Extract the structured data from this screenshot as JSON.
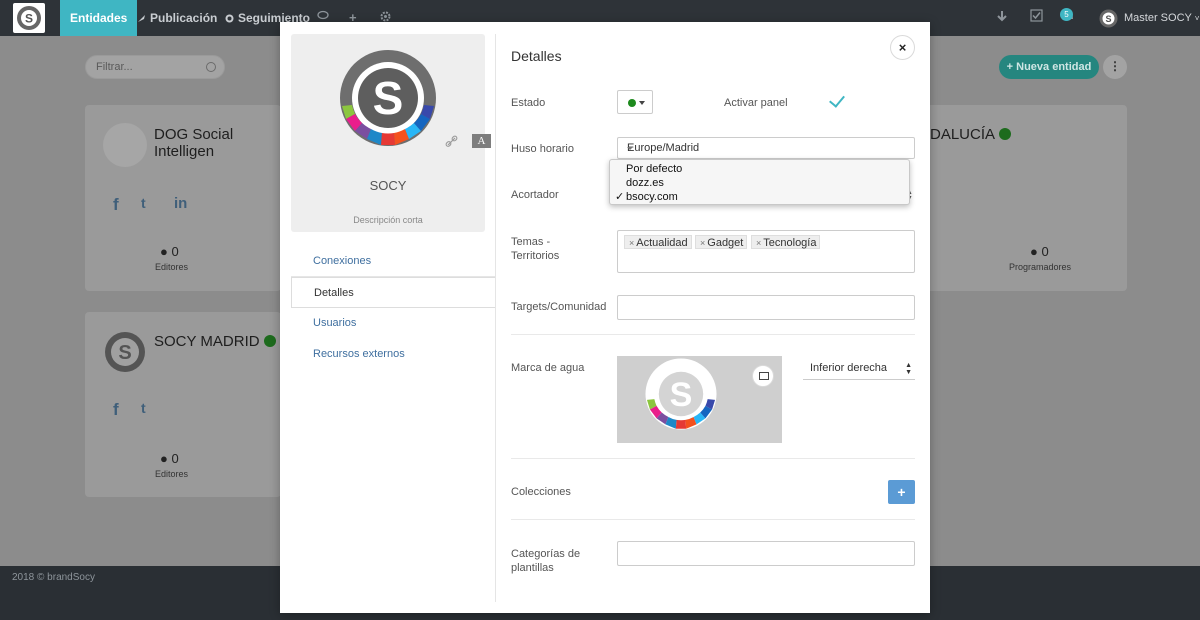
{
  "navbar": {
    "tabs": [
      {
        "label": "Entidades"
      },
      {
        "label": "Publicación"
      },
      {
        "label": "Seguimiento"
      }
    ],
    "notification_count": "5",
    "user_name": "Master SOCY"
  },
  "background": {
    "filter_placeholder": "Filtrar...",
    "new_entity_label": "Nueva entidad",
    "cards": [
      {
        "title": "DOG Social Intelligen",
        "count": "0",
        "count_label": "Editores"
      },
      {
        "title": "DALUCÍA",
        "count": "0",
        "count_label": "Programadores"
      },
      {
        "title": "SOCY MADRID",
        "count": "0",
        "count_label": "Editores"
      }
    ]
  },
  "footer": {
    "text": "2018 © brandSocy"
  },
  "modal": {
    "profile": {
      "name": "SOCY",
      "description": "Descripción corta",
      "font_icon_letter": "A"
    },
    "side_nav": [
      {
        "label": "Conexiones"
      },
      {
        "label": "Detalles"
      },
      {
        "label": "Usuarios"
      },
      {
        "label": "Recursos externos"
      }
    ],
    "title": "Detalles",
    "close": "×",
    "fields": {
      "estado": {
        "label": "Estado",
        "status_color": "#1d8a1d"
      },
      "activar_panel": {
        "label": "Activar panel",
        "checked": true
      },
      "huso_horario": {
        "label": "Huso horario",
        "value": "Europe/Madrid"
      },
      "acortador": {
        "label": "Acortador",
        "options": [
          "Por defecto",
          "dozz.es",
          "bsocy.com"
        ],
        "selected": "bsocy.com"
      },
      "temas": {
        "label_line1": "Temas -",
        "label_line2": "Territorios",
        "tags": [
          "Actualidad",
          "Gadget",
          "Tecnología"
        ]
      },
      "targets": {
        "label": "Targets/Comunidad",
        "value": ""
      },
      "marca_agua": {
        "label": "Marca de agua",
        "position": "Inferior derecha"
      },
      "colecciones": {
        "label": "Colecciones",
        "add": "+"
      },
      "categorias": {
        "label_line1": "Categorías de",
        "label_line2": "plantillas",
        "value": ""
      }
    }
  },
  "colors": {
    "accent": "#3fb6c3",
    "navbar": "#2e3338",
    "link": "#3f6f9f",
    "primary_button": "#5b9bd5"
  }
}
